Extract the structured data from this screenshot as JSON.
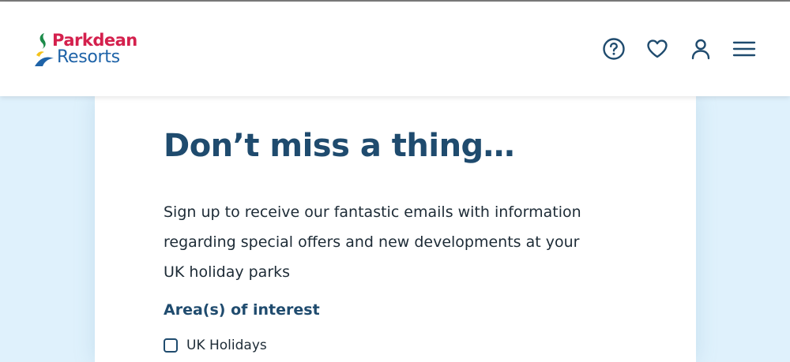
{
  "header": {
    "logo": {
      "line1": "Parkdean",
      "line2": "Resorts",
      "colors": {
        "line1": "#d4204d",
        "line2": "#1e63a8",
        "accent": "#f4c21a"
      }
    },
    "icons": [
      {
        "name": "help-icon",
        "label": "?"
      },
      {
        "name": "heart-icon",
        "label": ""
      },
      {
        "name": "user-icon",
        "label": ""
      },
      {
        "name": "menu-icon",
        "label": ""
      }
    ],
    "icon_color": "#1f4b6e"
  },
  "signup": {
    "title": "Don’t miss a thing…",
    "intro_lines": [
      "Sign up to receive our fantastic emails with information",
      "regarding special offers and new developments at your",
      "UK holiday parks"
    ],
    "interest_label": "Area(s) of interest",
    "options": [
      {
        "label": "UK Holidays",
        "checked": false
      }
    ]
  },
  "colors": {
    "page_background": "#dff1fc",
    "title": "#1f4b6e",
    "body_text": "#1d2b36"
  }
}
